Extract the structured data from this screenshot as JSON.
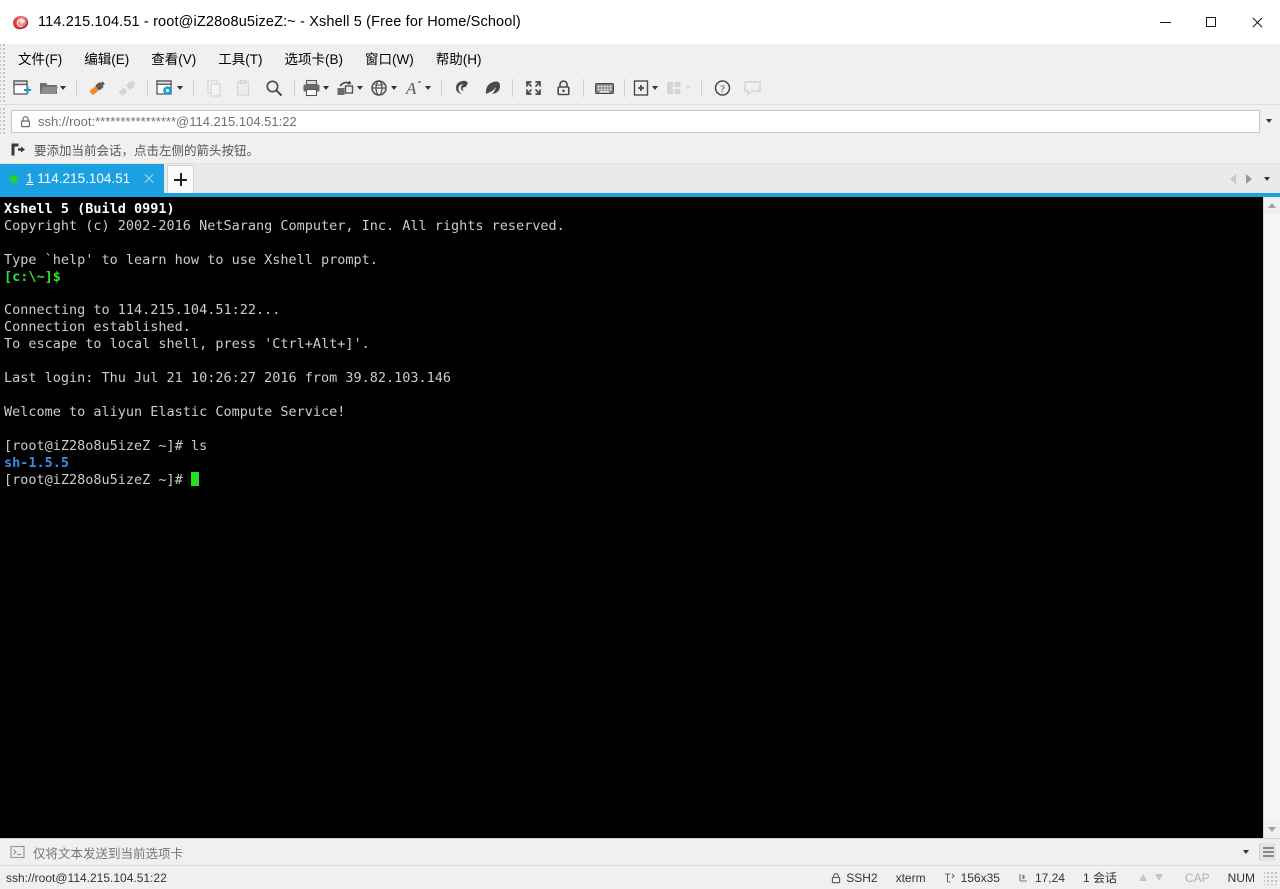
{
  "window": {
    "title": "114.215.104.51 - root@iZ28o8u5izeZ:~ - Xshell 5 (Free for Home/School)",
    "app_icon": "xshell-logo-icon",
    "controls": {
      "minimize": "minimize-button",
      "maximize": "maximize-button",
      "close": "close-button"
    }
  },
  "menubar": {
    "items": [
      {
        "label": "文件(F)",
        "name": "menu-file"
      },
      {
        "label": "编辑(E)",
        "name": "menu-edit"
      },
      {
        "label": "查看(V)",
        "name": "menu-view"
      },
      {
        "label": "工具(T)",
        "name": "menu-tools"
      },
      {
        "label": "选项卡(B)",
        "name": "menu-tabs"
      },
      {
        "label": "窗口(W)",
        "name": "menu-window"
      },
      {
        "label": "帮助(H)",
        "name": "menu-help"
      }
    ]
  },
  "toolbar": {
    "buttons": [
      {
        "name": "new-session-icon",
        "enabled": true,
        "caret": false
      },
      {
        "name": "open-folder-icon",
        "enabled": true,
        "caret": true
      },
      {
        "sep": true
      },
      {
        "name": "connect-icon",
        "enabled": true,
        "caret": false
      },
      {
        "name": "disconnect-icon",
        "enabled": false,
        "caret": false
      },
      {
        "sep": true
      },
      {
        "name": "session-properties-icon",
        "enabled": true,
        "caret": true
      },
      {
        "sep": true
      },
      {
        "name": "copy-icon",
        "enabled": false,
        "caret": false
      },
      {
        "name": "paste-icon",
        "enabled": false,
        "caret": false
      },
      {
        "name": "find-icon",
        "enabled": true,
        "caret": false
      },
      {
        "sep": true
      },
      {
        "name": "print-icon",
        "enabled": true,
        "caret": true
      },
      {
        "name": "file-transfer-icon",
        "enabled": true,
        "caret": true
      },
      {
        "name": "globe-icon",
        "enabled": true,
        "caret": true
      },
      {
        "name": "font-icon",
        "enabled": true,
        "caret": true
      },
      {
        "sep": true
      },
      {
        "name": "xftp-icon",
        "enabled": true,
        "caret": false
      },
      {
        "name": "xagent-icon",
        "enabled": true,
        "caret": false
      },
      {
        "sep": true
      },
      {
        "name": "fullscreen-icon",
        "enabled": true,
        "caret": false
      },
      {
        "name": "lock-icon",
        "enabled": true,
        "caret": false
      },
      {
        "sep": true
      },
      {
        "name": "keyboard-icon",
        "enabled": true,
        "caret": false
      },
      {
        "sep": true
      },
      {
        "name": "add-to-folder-icon",
        "enabled": true,
        "caret": true
      },
      {
        "name": "layout-icon",
        "enabled": false,
        "caret": true
      },
      {
        "sep": true
      },
      {
        "name": "help-icon",
        "enabled": true,
        "caret": false
      },
      {
        "name": "chat-icon",
        "enabled": false,
        "caret": false
      }
    ]
  },
  "address_bar": {
    "lock_icon": "lock-icon",
    "value": "ssh://root:****************@114.215.104.51:22",
    "placeholder": "ssh://root:****************@114.215.104.51:22",
    "dropdown_icon": "chevron-down-icon"
  },
  "notice_bar": {
    "icon": "add-session-arrow-icon",
    "text": "要添加当前会话，点击左侧的箭头按钮。"
  },
  "tabbar": {
    "accent_color": "#1ba1e2",
    "tabs": [
      {
        "index": "1",
        "title": "114.215.104.51",
        "status_dot_color": "#23d423",
        "active": true
      }
    ],
    "new_tab_label": "+",
    "nav_prev_icon": "chevron-left-icon",
    "nav_next_icon": "chevron-right-icon",
    "overflow_icon": "chevron-down-icon"
  },
  "terminal": {
    "background": "#000000",
    "foreground": "#cccccc",
    "cursor_color": "#26e026",
    "lines": [
      {
        "text": "Xshell 5 (Build 0991)",
        "style": "bold"
      },
      {
        "text": "Copyright (c) 2002-2016 NetSarang Computer, Inc. All rights reserved.",
        "style": "normal"
      },
      {
        "text": "",
        "style": "normal"
      },
      {
        "text": "Type `help' to learn how to use Xshell prompt.",
        "style": "normal"
      },
      {
        "text": "[c:\\~]$",
        "style": "green"
      },
      {
        "text": "",
        "style": "normal"
      },
      {
        "text": "Connecting to 114.215.104.51:22...",
        "style": "normal"
      },
      {
        "text": "Connection established.",
        "style": "normal"
      },
      {
        "text": "To escape to local shell, press 'Ctrl+Alt+]'.",
        "style": "normal"
      },
      {
        "text": "",
        "style": "normal"
      },
      {
        "text": "Last login: Thu Jul 21 10:26:27 2016 from 39.82.103.146",
        "style": "normal"
      },
      {
        "text": "",
        "style": "normal"
      },
      {
        "text": "Welcome to aliyun Elastic Compute Service!",
        "style": "normal"
      },
      {
        "text": "",
        "style": "normal"
      },
      {
        "text": "[root@iZ28o8u5izeZ ~]# ls",
        "style": "normal"
      },
      {
        "text": "sh-1.5.5",
        "style": "blue"
      },
      {
        "text": "[root@iZ28o8u5izeZ ~]# ",
        "style": "normal",
        "cursor": true
      }
    ]
  },
  "scrollbar": {
    "up_icon": "chevron-up-icon",
    "down_icon": "chevron-down-icon"
  },
  "send_bar": {
    "icon": "terminal-prompt-icon",
    "text": "仅将文本发送到当前选项卡",
    "dropdown_icon": "chevron-down-icon",
    "menu_icon": "hamburger-menu-icon"
  },
  "statusbar": {
    "connection": "ssh://root@114.215.104.51:22",
    "protocol": "SSH2",
    "protocol_icon": "lock-icon",
    "terminal_type": "xterm",
    "size_icon": "terminal-size-icon",
    "size": "156x35",
    "cursor_icon": "cursor-position-icon",
    "cursor_position": "17,24",
    "sessions": "1 会话",
    "upload_icon": "arrow-up-icon",
    "download_icon": "arrow-down-icon",
    "cap": "CAP",
    "num": "NUM"
  }
}
